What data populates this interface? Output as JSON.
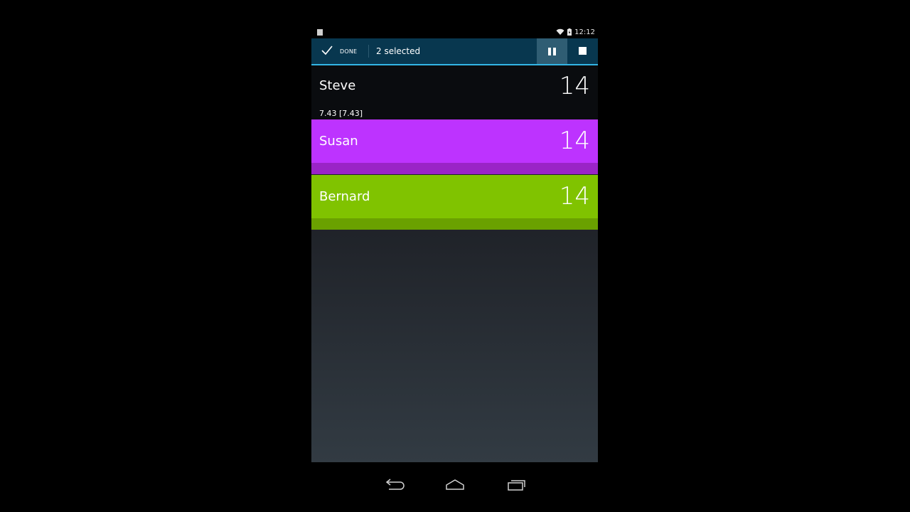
{
  "status_bar": {
    "time": "12:12"
  },
  "action_bar": {
    "done_label": "DONE",
    "selection_text": "2 selected",
    "pause_icon": "pause-icon",
    "stop_icon": "stop-icon"
  },
  "players": [
    {
      "name": "Steve",
      "score": "14",
      "sub": "7.43 [7.43]",
      "color": "#0a0c0f"
    },
    {
      "name": "Susan",
      "score": "14",
      "color": "#bd33ff"
    },
    {
      "name": "Bernard",
      "score": "14",
      "color": "#80c300"
    }
  ],
  "nav_bar": {
    "back_icon": "back-icon",
    "home_icon": "home-icon",
    "recents_icon": "recents-icon"
  },
  "colors": {
    "action_bar_bg": "#08374f",
    "action_bar_accent": "#33b5e5",
    "pause_button_active": "#2f5d73"
  }
}
